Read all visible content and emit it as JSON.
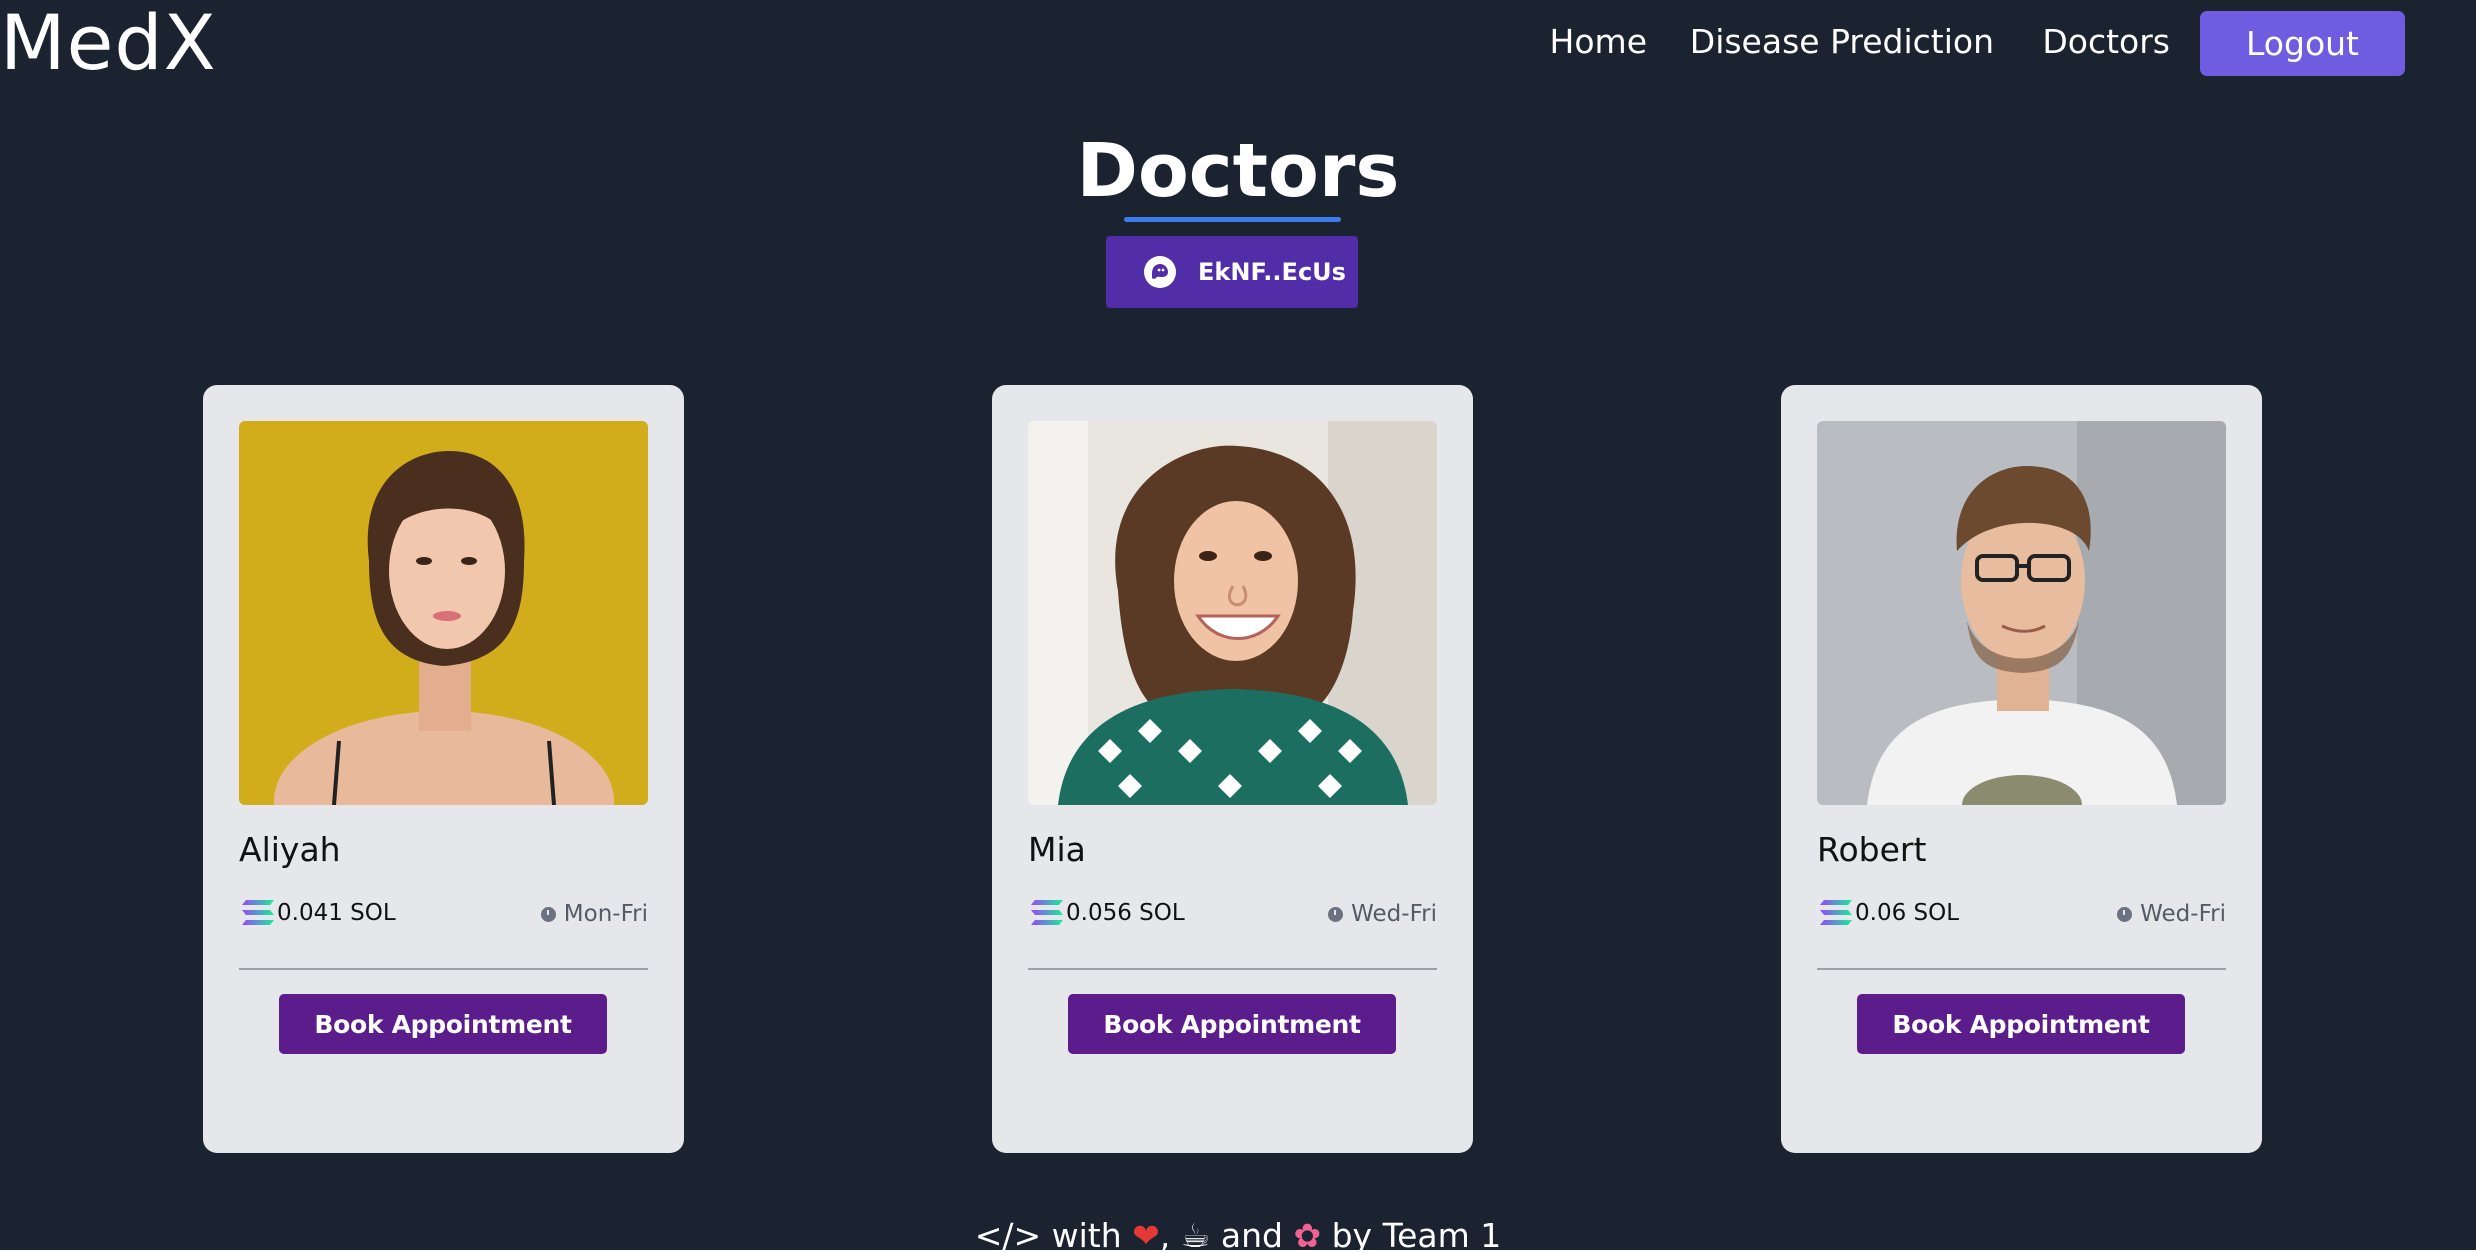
{
  "header": {
    "logo": "MedX",
    "nav": [
      {
        "label": "Home"
      },
      {
        "label": "Disease Prediction"
      },
      {
        "label": "Doctors"
      }
    ],
    "logout_label": "Logout"
  },
  "main": {
    "title": "Doctors",
    "wallet": {
      "address": "EkNF..EcUs",
      "icon": "phantom-ghost-icon"
    }
  },
  "doctors": [
    {
      "name": "Aliyah",
      "price": "0.041 SOL",
      "schedule": "Mon-Fri",
      "button": "Book Appointment"
    },
    {
      "name": "Mia",
      "price": "0.056 SOL",
      "schedule": "Wed-Fri",
      "button": "Book Appointment"
    },
    {
      "name": "Robert",
      "price": "0.06 SOL",
      "schedule": "Wed-Fri",
      "button": "Book Appointment"
    }
  ],
  "footer": {
    "text_code": "</> with",
    "text_and": "and",
    "text_by": "by Team 1"
  },
  "colors": {
    "background": "#1b2230",
    "accent": "#6f5ce0",
    "wallet_button": "#512da8",
    "book_button": "#5b1c8c",
    "card": "#e5e7eb",
    "underline": "#3b7be8"
  }
}
